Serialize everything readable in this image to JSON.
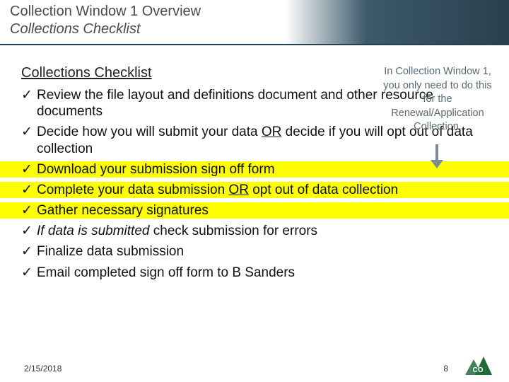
{
  "header": {
    "title": "Collection Window 1 Overview",
    "subtitle": "Collections Checklist"
  },
  "section_title": "Collections Checklist",
  "checkmark": "✓",
  "items": [
    {
      "pre": "Review the file layout and definitions document and other resource documents",
      "hl": false
    },
    {
      "pre": "Decide how you will submit your data ",
      "und": "OR",
      "post": " decide if you will opt out of data collection",
      "hl": false
    },
    {
      "pre": "Download your submission sign off form",
      "hl": true
    },
    {
      "pre": "Complete your data submission ",
      "und": "OR",
      "post": " opt out of data collection",
      "hl": true
    },
    {
      "pre": "Gather necessary signatures",
      "hl": true
    },
    {
      "ital": "If data is submitted",
      "post": " check submission for errors",
      "hl": false
    },
    {
      "pre": "Finalize data submission",
      "hl": false
    },
    {
      "pre": "Email completed sign off form to B Sanders",
      "hl": false
    }
  ],
  "callout": {
    "l1": "In Collection Window 1,",
    "l2": "you only need to do this",
    "l3": "for the",
    "l4": "Renewal/Application",
    "l5": "Collection."
  },
  "footer": {
    "date": "2/15/2018",
    "page": "8",
    "logo_text": "CO"
  }
}
